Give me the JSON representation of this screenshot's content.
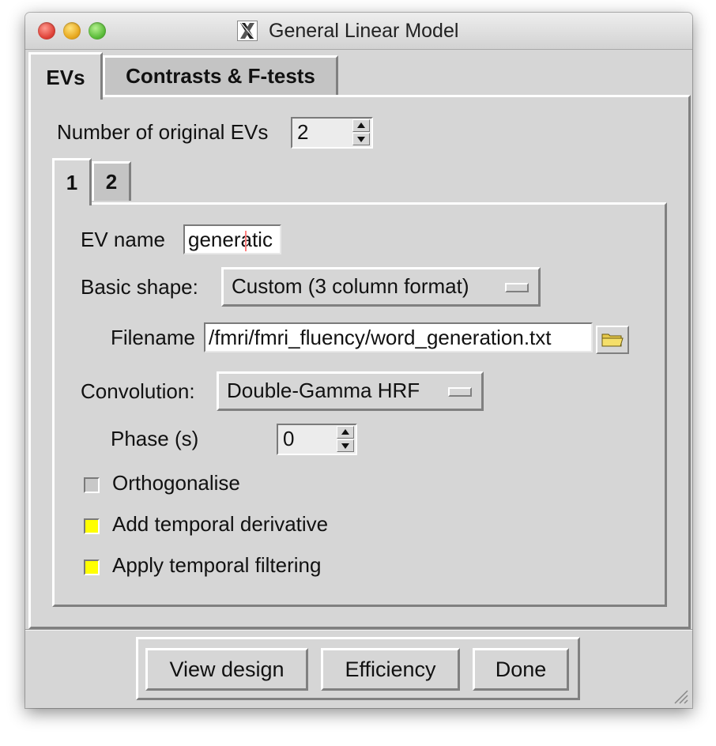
{
  "window": {
    "title": "General Linear Model"
  },
  "outer_tabs": [
    {
      "label": "EVs",
      "active": true
    },
    {
      "label": "Contrasts & F-tests",
      "active": false
    }
  ],
  "num_evs": {
    "label": "Number of original EVs",
    "value": "2"
  },
  "ev_tabs": [
    {
      "label": "1",
      "active": true
    },
    {
      "label": "2",
      "active": false
    }
  ],
  "ev_panel": {
    "ev_name_label": "EV name",
    "ev_name_value": "generatic",
    "basic_shape_label": "Basic shape:",
    "basic_shape_value": "Custom (3 column format)",
    "filename_label": "Filename",
    "filename_value": "/fmri/fmri_fluency/word_generation.txt",
    "convolution_label": "Convolution:",
    "convolution_value": "Double-Gamma HRF",
    "phase_label": "Phase (s)",
    "phase_value": "0",
    "checkboxes": [
      {
        "label": "Orthogonalise",
        "checked": false
      },
      {
        "label": "Add temporal derivative",
        "checked": true
      },
      {
        "label": "Apply temporal filtering",
        "checked": true
      }
    ]
  },
  "buttons": {
    "view_design": "View design",
    "efficiency": "Efficiency",
    "done": "Done"
  },
  "colors": {
    "window_bg": "#d6d6d6",
    "checkbox_checked": "#ffff00",
    "checkbox_unchecked": "#c8c8c8"
  }
}
